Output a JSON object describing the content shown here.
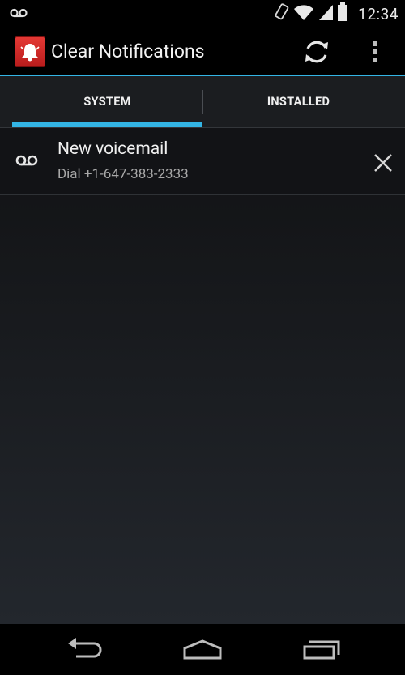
{
  "status_bar": {
    "time": "12:34",
    "icons": [
      "voicemail-icon",
      "rotation-icon",
      "wifi-icon",
      "cell-signal-icon",
      "battery-icon"
    ]
  },
  "action_bar": {
    "title": "Clear Notifications",
    "app_icon": "bell-icon",
    "actions": [
      "refresh-icon",
      "overflow-menu-icon"
    ],
    "accent_color": "#33b5e5"
  },
  "tabs": [
    {
      "label": "SYSTEM",
      "selected": true
    },
    {
      "label": "INSTALLED",
      "selected": false
    }
  ],
  "notifications": [
    {
      "icon": "voicemail-icon",
      "title": "New voicemail",
      "subtitle": "Dial +1-647-383-2333"
    }
  ],
  "nav_bar": {
    "buttons": [
      "back-icon",
      "home-icon",
      "recents-icon"
    ]
  }
}
